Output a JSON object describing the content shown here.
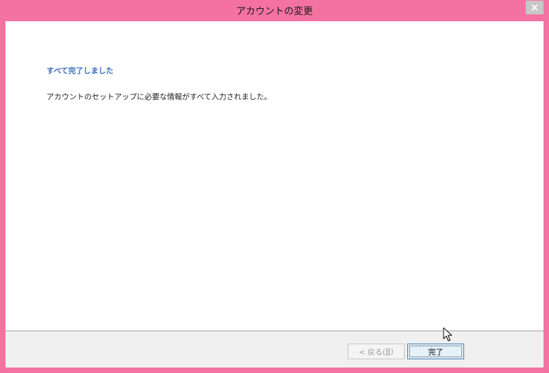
{
  "window": {
    "title": "アカウントの変更"
  },
  "content": {
    "heading": "すべて完了しました",
    "message": "アカウントのセットアップに必要な情報がすべて入力されました。"
  },
  "footer": {
    "back_prefix": "< 戻る(",
    "back_accel": "B",
    "back_suffix": ")",
    "finish_label": "完了"
  },
  "colors": {
    "frame": "#f4729f",
    "heading": "#3c6cbf"
  }
}
